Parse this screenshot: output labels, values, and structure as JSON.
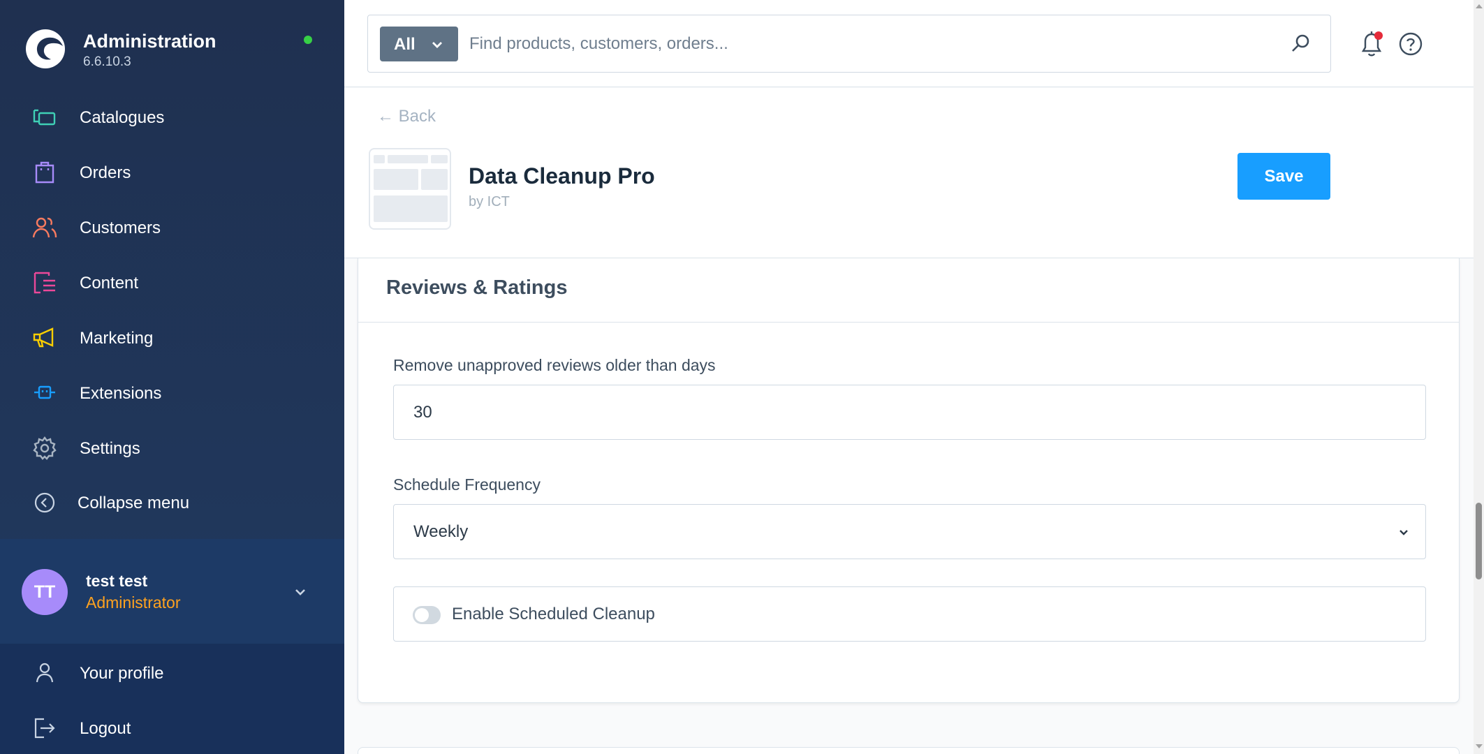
{
  "sidebar": {
    "title": "Administration",
    "version": "6.6.10.3",
    "items": [
      {
        "label": "Catalogues",
        "icon": "catalogues-icon",
        "color": "#3fd0b5"
      },
      {
        "label": "Orders",
        "icon": "orders-icon",
        "color": "#a78bfa"
      },
      {
        "label": "Customers",
        "icon": "customers-icon",
        "color": "#f97b5f"
      },
      {
        "label": "Content",
        "icon": "content-icon",
        "color": "#ec4899"
      },
      {
        "label": "Marketing",
        "icon": "marketing-icon",
        "color": "#fbce00"
      },
      {
        "label": "Extensions",
        "icon": "extensions-icon",
        "color": "#189eff"
      },
      {
        "label": "Settings",
        "icon": "settings-icon",
        "color": "#a8b4c2"
      }
    ],
    "collapse_label": "Collapse menu",
    "user": {
      "initials": "TT",
      "name": "test test",
      "role": "Administrator"
    },
    "profile_label": "Your profile",
    "logout_label": "Logout"
  },
  "topbar": {
    "search_type": "All",
    "search_placeholder": "Find products, customers, orders..."
  },
  "header": {
    "back_label": "Back",
    "title": "Data Cleanup Pro",
    "author": "by ICT",
    "save_label": "Save"
  },
  "card": {
    "title": "Reviews & Ratings",
    "days_label": "Remove unapproved reviews older than days",
    "days_value": "30",
    "frequency_label": "Schedule Frequency",
    "frequency_value": "Weekly",
    "toggle_label": "Enable Scheduled Cleanup",
    "toggle_on": false
  },
  "colors": {
    "accent": "#189eff",
    "sidebar_bg": "#1f3050",
    "role": "#ffa21f",
    "online": "#37d046"
  }
}
